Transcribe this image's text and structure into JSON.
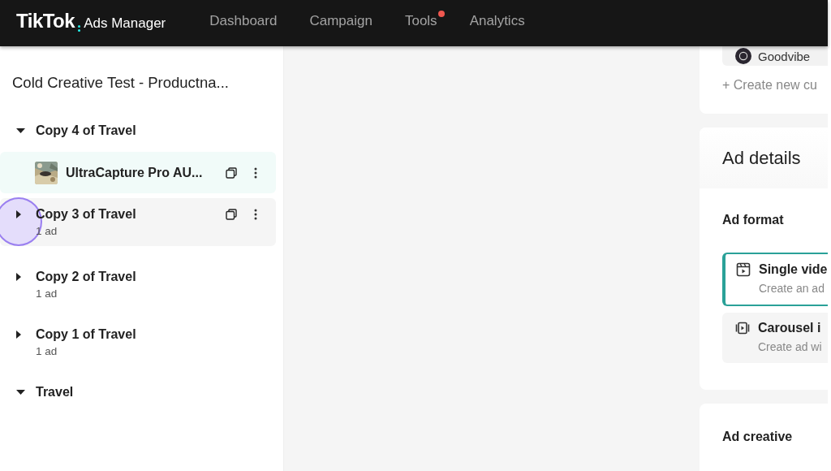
{
  "header": {
    "logo": "TikTok",
    "product": "Ads Manager",
    "nav": [
      {
        "label": "Dashboard",
        "badge": false
      },
      {
        "label": "Campaign",
        "badge": false
      },
      {
        "label": "Tools",
        "badge": true
      },
      {
        "label": "Analytics",
        "badge": false
      }
    ]
  },
  "sidebar": {
    "title": "Cold Creative Test - Productna...",
    "groups": [
      {
        "name": "Copy 4 of Travel",
        "expanded": true,
        "highlighted": false,
        "clicked": false,
        "children": [
          {
            "name": "UltraCapture Pro AU...",
            "selected": true
          }
        ]
      },
      {
        "name": "Copy 3 of Travel",
        "count": "1 ad",
        "expanded": false,
        "highlighted": true,
        "clicked": true
      },
      {
        "name": "Copy 2 of Travel",
        "count": "1 ad",
        "expanded": false,
        "highlighted": false,
        "clicked": false
      },
      {
        "name": "Copy 1 of Travel",
        "count": "1 ad",
        "expanded": false,
        "highlighted": false,
        "clicked": false
      },
      {
        "name": "Travel",
        "expanded": true,
        "highlighted": false,
        "clicked": false
      }
    ]
  },
  "identity": {
    "account": "Goodvibe",
    "create_link": "+ Create new cu"
  },
  "ad_details": {
    "title": "Ad details",
    "format_label": "Ad format",
    "formats": [
      {
        "kind": "video",
        "title": "Single vide",
        "description": "Create an ad",
        "selected": true
      },
      {
        "kind": "carousel",
        "title": "Carousel i",
        "description": "Create ad wi",
        "selected": false
      }
    ]
  },
  "ad_creative": {
    "title": "Ad creative"
  }
}
